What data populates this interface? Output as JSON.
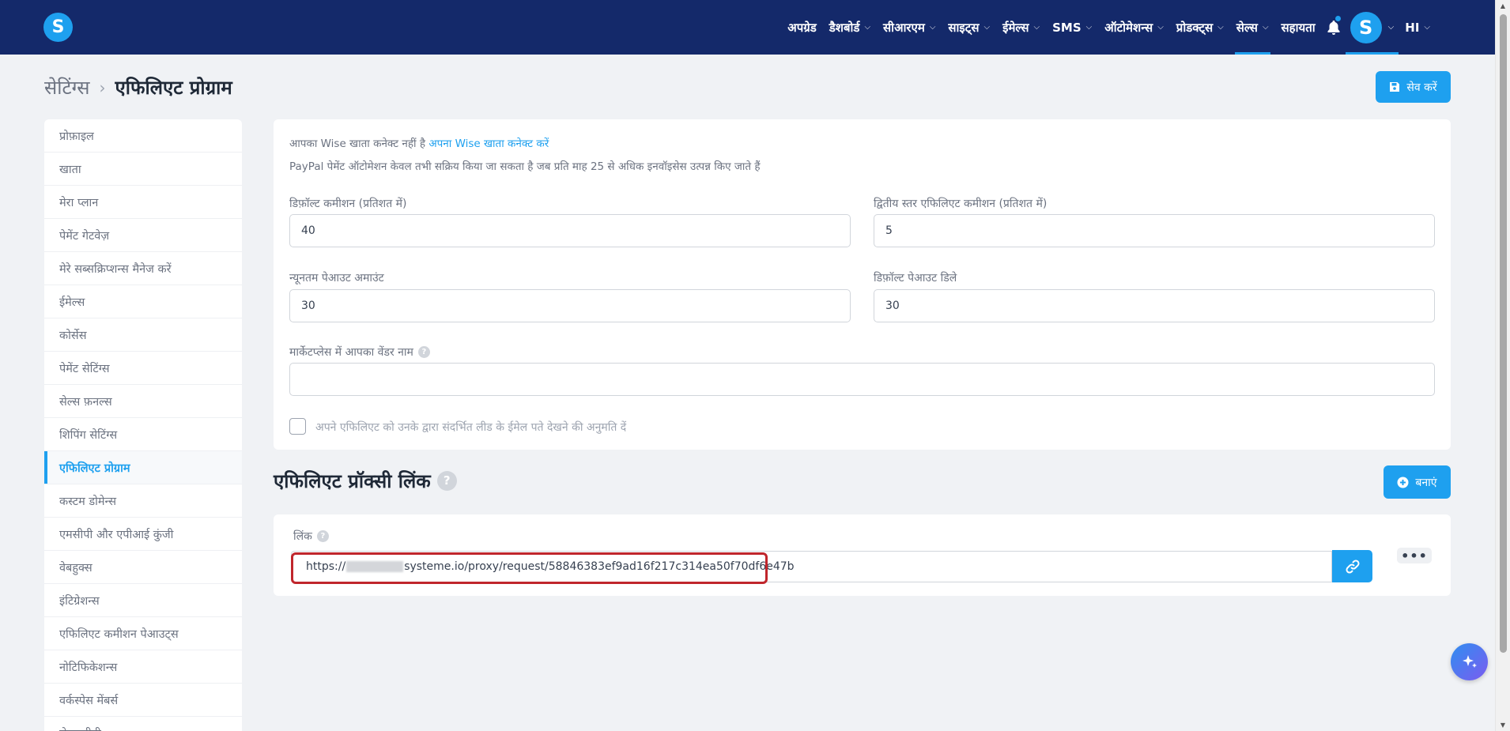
{
  "brand": {
    "logo_letter": "S"
  },
  "nav": {
    "items": [
      {
        "label": "अपग्रेड",
        "has_dropdown": false
      },
      {
        "label": "डैशबोर्ड",
        "has_dropdown": true
      },
      {
        "label": "सीआरएम",
        "has_dropdown": true
      },
      {
        "label": "साइट्स",
        "has_dropdown": true
      },
      {
        "label": "ईमेल्स",
        "has_dropdown": true
      },
      {
        "label": "SMS",
        "has_dropdown": true
      },
      {
        "label": "ऑटोमेशन्स",
        "has_dropdown": true
      },
      {
        "label": "प्रोडक्ट्स",
        "has_dropdown": true
      },
      {
        "label": "सेल्स",
        "has_dropdown": true
      },
      {
        "label": "सहायता",
        "has_dropdown": false
      }
    ],
    "active": "सेल्स",
    "avatar_letter": "S",
    "language": "HI"
  },
  "breadcrumb": {
    "parent": "सेटिंग्स",
    "current": "एफिलिएट प्रोग्राम"
  },
  "save_button": {
    "label": "सेव करें"
  },
  "sidebar": {
    "items": [
      "प्रोफ़ाइल",
      "खाता",
      "मेरा प्लान",
      "पेमेंट गेटवेज़",
      "मेरे सब्सक्रिप्शन्स मैनेज करें",
      "ईमेल्स",
      "कोर्सेस",
      "पेमेंट सेटिंग्स",
      "सेल्स फ़नल्स",
      "शिपिंग सेटिंग्स",
      "एफिलिएट प्रोग्राम",
      "कस्टम डोमेन्स",
      "एमसीपी और एपीआई कुंजी",
      "वेबहुक्स",
      "इंटिग्रेशन्स",
      "एफिलिएट कमीशन पेआउट्स",
      "नोटिफिकेशन्स",
      "वर्कस्पेस मेंबर्स",
      "सेल्सजीपी"
    ],
    "active": "एफिलिएट प्रोग्राम"
  },
  "settings_card": {
    "wise_notice": "आपका Wise खाता कनेक्ट नहीं है",
    "wise_link": "अपना Wise खाता कनेक्ट करें",
    "paypal_notice": "PayPal पेमेंट ऑटोमेशन केवल तभी सक्रिय किया जा सकता है जब प्रति माह 25 से अधिक इनवॉइसेस उत्पन्न किए जाते हैं",
    "default_commission": {
      "label": "डिफ़ॉल्ट कमीशन (प्रतिशत में)",
      "value": "40"
    },
    "second_level_commission": {
      "label": "द्वितीय स्तर एफिलिएट कमीशन (प्रतिशत में)",
      "value": "5"
    },
    "min_payout": {
      "label": "न्यूनतम पेआउट अमाउंट",
      "value": "30"
    },
    "default_payout_delay": {
      "label": "डिफ़ॉल्ट पेआउट डिले",
      "value": "30"
    },
    "vendor_name": {
      "label": "मार्केटप्लेस में आपका वेंडर नाम",
      "value": ""
    },
    "allow_emails_checkbox": {
      "label": "अपने एफिलिएट को उनके द्वारा संदर्भित लीड के ईमेल पते देखने की अनुमति दें",
      "checked": false
    }
  },
  "proxy_section": {
    "title": "एफिलिएट प्रॉक्सी लिंक",
    "create_button": "बनाएं",
    "link_label": "लिंक",
    "link_prefix": "https://",
    "link_suffix": "systeme.io/proxy/request/58846383ef9ad16f217c314ea50f70df6e47b"
  },
  "colors": {
    "nav_bg": "#14296a",
    "accent": "#1ea0ef",
    "highlight_border": "#c0262c",
    "page_bg": "#f0f2f5"
  },
  "icons": {
    "save": "floppy-disk-icon",
    "bell": "bell-icon",
    "create": "plus-circle-icon",
    "link": "link-icon",
    "more": "ellipsis-icon",
    "fab": "sparkle-icon"
  }
}
